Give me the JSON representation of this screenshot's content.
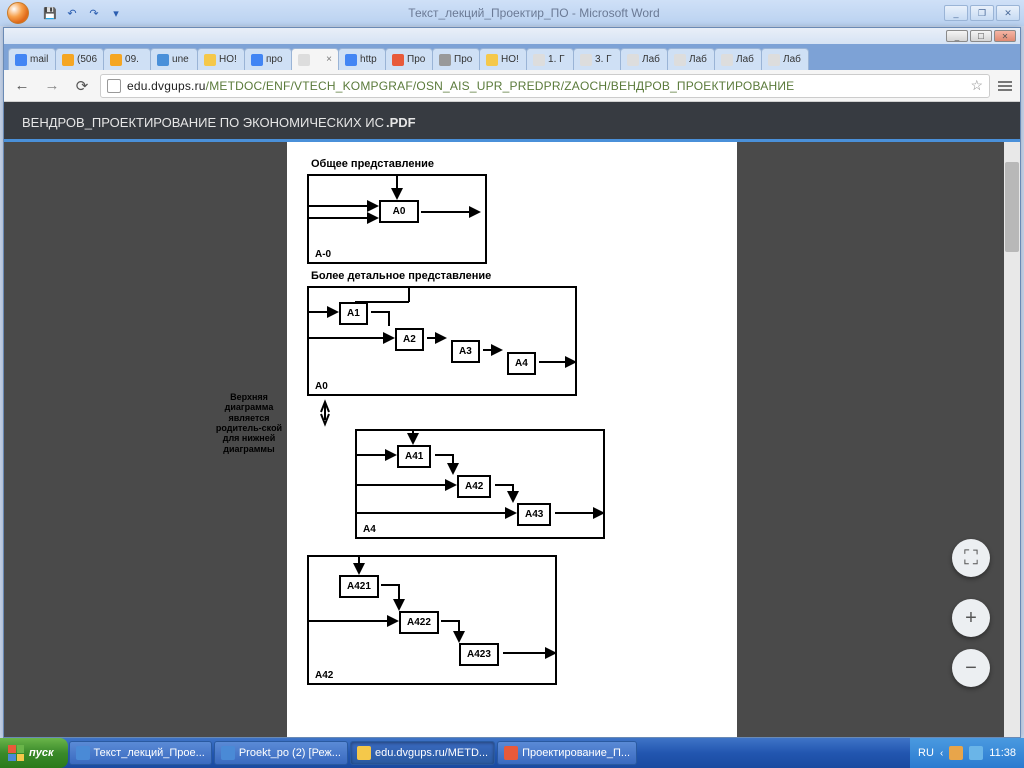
{
  "word": {
    "title": "Текст_лекций_Проектир_ПО - Microsoft Word",
    "qat": {
      "save": "💾",
      "undo": "↶",
      "redo": "↷",
      "more": "▾"
    }
  },
  "chrome": {
    "tabs": [
      {
        "label": "mail",
        "fav": "#4285f4"
      },
      {
        "label": "(506",
        "fav": "#f5a623"
      },
      {
        "label": "09.",
        "fav": "#f5a623"
      },
      {
        "label": "une",
        "fav": "#4a90d9"
      },
      {
        "label": "НО!",
        "fav": "#f5c84a"
      },
      {
        "label": "про",
        "fav": "#4285f4"
      },
      {
        "label": "",
        "fav": "#ddd",
        "active": true,
        "close": "×"
      },
      {
        "label": "http",
        "fav": "#4285f4"
      },
      {
        "label": "Про",
        "fav": "#e85a3a"
      },
      {
        "label": "Про",
        "fav": "#999"
      },
      {
        "label": "НО!",
        "fav": "#f5c84a"
      },
      {
        "label": "1. Г",
        "fav": "#ddd"
      },
      {
        "label": "3. Г",
        "fav": "#ddd"
      },
      {
        "label": "Лаб",
        "fav": "#ddd"
      },
      {
        "label": "Лаб",
        "fav": "#ddd"
      },
      {
        "label": "Лаб",
        "fav": "#ddd"
      },
      {
        "label": "Лаб",
        "fav": "#ddd"
      }
    ],
    "url_host": "edu.dvgups.ru",
    "url_path": "/METDOC/ENF/VTECH_KOMPGRAF/OSN_AIS_UPR_PREDPR/ZAOCH/ВЕНДРОВ_ПРОЕКТИРОВАНИЕ",
    "back": "←",
    "fwd": "→",
    "reload": "⟳",
    "star": "☆"
  },
  "pdf": {
    "title_prefix": "ВЕНДРОВ_ПРОЕКТИРОВАНИЕ ПО ЭКОНОМИЧЕСКИХ ИС",
    "title_suffix": ".PDF",
    "fit": "⛶",
    "plus": "+",
    "minus": "−"
  },
  "diag": {
    "h1": "Общее представление",
    "h2": "Более детальное представление",
    "side": "Верхняя диаграмма является родитель-ской для нижней диаграммы",
    "boxes": {
      "a0": "A0",
      "a_0": "A-0",
      "a1": "A1",
      "a2": "A2",
      "a3": "A3",
      "a4": "A4",
      "lvl_a0": "A0",
      "a41": "A41",
      "a42": "A42",
      "a43": "A43",
      "lvl_a4": "A4",
      "a421": "A421",
      "a422": "A422",
      "a423": "A423",
      "lvl_a42": "A42"
    }
  },
  "taskbar": {
    "start": "пуск",
    "items": [
      {
        "label": "Текст_лекций_Прое...",
        "ic": "#4a8ad6"
      },
      {
        "label": "Proekt_po (2) [Реж...",
        "ic": "#4a8ad6"
      },
      {
        "label": "edu.dvgups.ru/METD...",
        "ic": "#f5c84a",
        "active": true
      },
      {
        "label": "Проектирование_П...",
        "ic": "#e85a3a"
      }
    ],
    "lang": "RU",
    "clock": "11:38"
  }
}
